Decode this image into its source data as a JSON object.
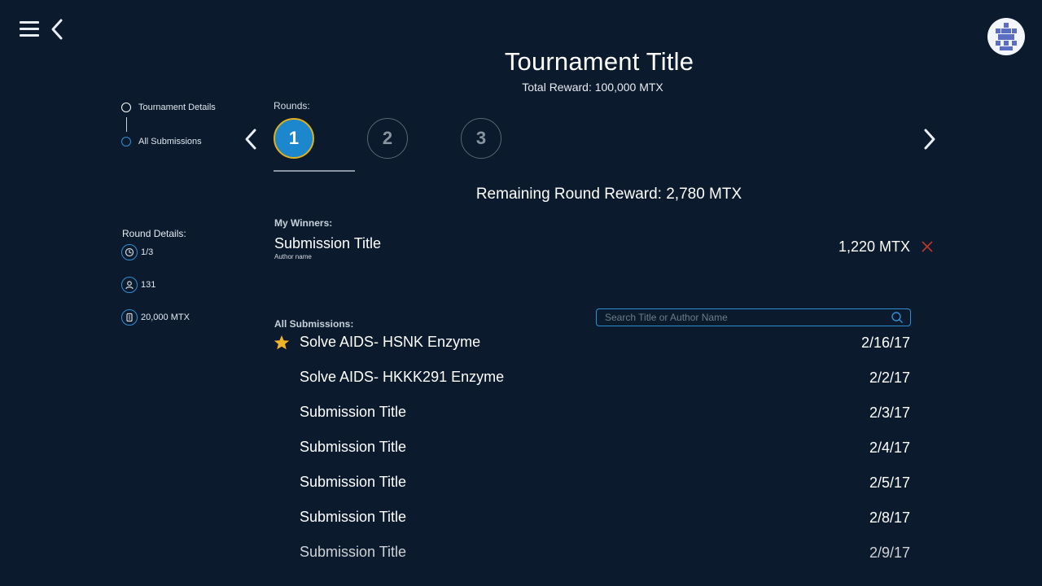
{
  "header": {
    "title": "Tournament Title",
    "total_reward": "Total Reward: 100,000 MTX"
  },
  "nav": {
    "steps": [
      {
        "label": "Tournament Details",
        "state": "active"
      },
      {
        "label": "All Submissions",
        "state": "inactive"
      }
    ]
  },
  "round_details": {
    "label": "Round Details:",
    "items": [
      {
        "icon": "round-progress-icon",
        "text": "1/3"
      },
      {
        "icon": "user-icon",
        "text": "131"
      },
      {
        "icon": "reward-icon",
        "text": "20,000 MTX"
      }
    ]
  },
  "rounds": {
    "label": "Rounds:",
    "items": [
      "1",
      "2",
      "3"
    ],
    "selected": "1"
  },
  "remaining": "Remaining Round Reward: 2,780 MTX",
  "winners": {
    "label": "My Winners:",
    "title": "Submission Title",
    "author": "Author name",
    "amount": "1,220 MTX"
  },
  "submissions": {
    "label": "All Submissions:",
    "search_placeholder": "Search Title or Author Name",
    "rows": [
      {
        "title": "Solve AIDS- HSNK Enzyme",
        "date": "2/16/17",
        "starred": true
      },
      {
        "title": "Solve AIDS- HKKK291 Enzyme",
        "date": "2/2/17",
        "starred": false
      },
      {
        "title": "Submission Title",
        "date": "2/3/17",
        "starred": false
      },
      {
        "title": "Submission Title",
        "date": "2/4/17",
        "starred": false
      },
      {
        "title": "Submission Title",
        "date": "2/5/17",
        "starred": false
      },
      {
        "title": "Submission Title",
        "date": "2/8/17",
        "starred": false
      },
      {
        "title": "Submission Title",
        "date": "2/9/17",
        "starred": false
      }
    ]
  },
  "colors": {
    "background": "#0b1a2c",
    "accent": "#1c87cd",
    "selected_ring": "#e0b11d",
    "star": "#f0b429",
    "remove": "#c0392b"
  }
}
